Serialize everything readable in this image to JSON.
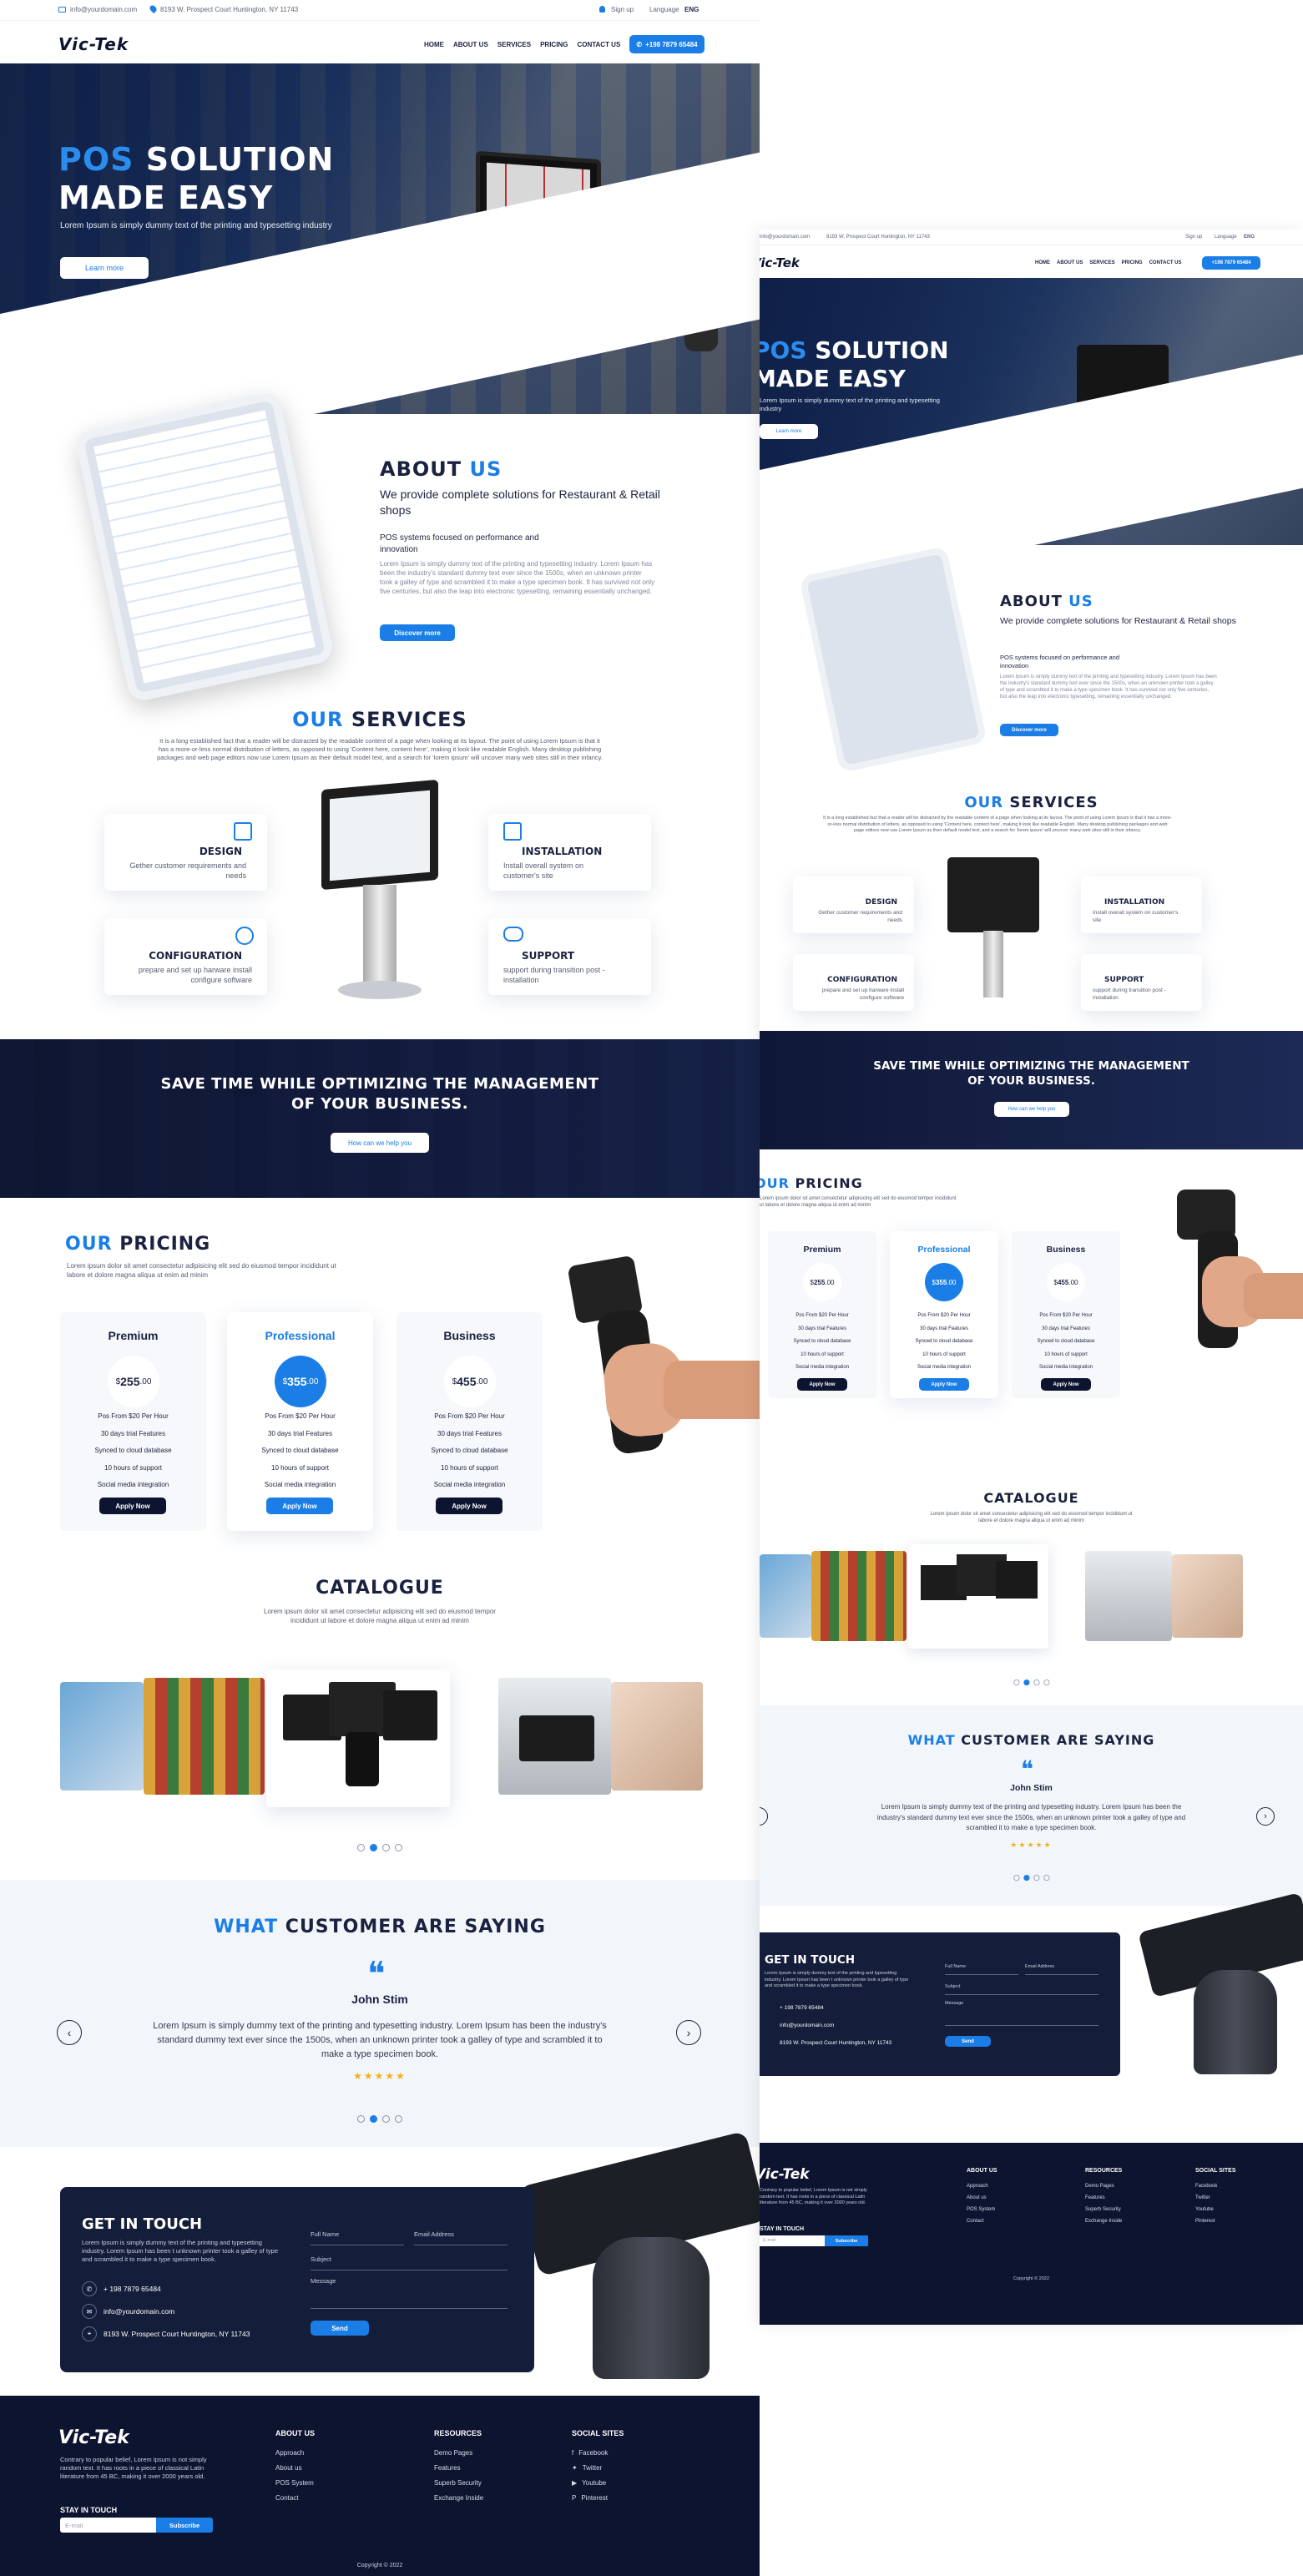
{
  "topbar": {
    "email": "info@yourdomain.com",
    "address": "8193 W. Prospect Court Huntington, NY 11743",
    "signup": "Sign up",
    "language": "Language",
    "lang_code": "ENG"
  },
  "brand": {
    "logo": "Vic-Tek",
    "accent": "#1a7ee6",
    "navy": "#0d1430"
  },
  "nav": {
    "items": [
      "HOME",
      "ABOUT US",
      "SERVICES",
      "PRICING",
      "CONTACT US"
    ],
    "phone": "+198 7879 65484"
  },
  "hero": {
    "title_accent": "POS",
    "title_rest": "SOLUTION",
    "title_line2": "MADE EASY",
    "subtitle": "Lorem Ipsum is simply dummy text of the printing and typesetting industry",
    "button": "Learn more"
  },
  "about": {
    "title_a": "ABOUT",
    "title_b": "US",
    "lead": "We provide complete solutions for  Restaurant & Retail shops",
    "sub": "POS systems focused on performance and innovation",
    "body": "Lorem Ipsum is simply dummy text of the printing and typesetting industry. Lorem Ipsum has been the industry's standard dummy text ever since the 1500s, when an unknown printer took a galley of type and scrambled it to make a type specimen book. It has survived not only five centuries, but also the leap into electronic typesetting, remaining essentially unchanged.",
    "button": "Discover more"
  },
  "services": {
    "title_a": "OUR",
    "title_b": "SERVICES",
    "intro": "It is a long established fact that a reader will be distracted by the readable content of a page when looking at its layout. The point of using Lorem Ipsum is that it has a more-or-less normal distribution of letters, as opposed to using 'Content here, content here', making it look like readable English. Many desktop publishing packages and web page editors now use Lorem Ipsum as their default model text, and a search for 'lorem ipsum' will uncover many web sites still in their infancy.",
    "items": [
      {
        "name": "DESIGN",
        "desc": "Gether customer requirements and needs",
        "icon": "design-icon"
      },
      {
        "name": "INSTALLATION",
        "desc": "Install overall system on customer's site",
        "icon": "installation-icon"
      },
      {
        "name": "CONFIGURATION",
        "desc": "prepare and set up harware install configure software",
        "icon": "configuration-icon"
      },
      {
        "name": "SUPPORT",
        "desc": "support during transition post - installation",
        "icon": "support-icon"
      }
    ]
  },
  "banner": {
    "line1": "SAVE TIME WHILE OPTIMIZING THE MANAGEMENT",
    "line2": "OF YOUR BUSINESS.",
    "button": "How can we help you"
  },
  "pricing": {
    "title_a": "OUR",
    "title_b": "PRICING",
    "intro": "Lorem ipsum dolor sit amet consectetur adipisicing elit sed do eiusmod tempor incididunt ut labore et dolore magna aliqua ut enim ad minim",
    "plans": [
      {
        "name": "Premium",
        "currency": "$",
        "price": "255",
        "cents": ".00",
        "features": [
          "Pos From $20 Per Hour",
          "30 days trial Features",
          "Synced to cloud database",
          "10 hours of support",
          "Social media integration"
        ],
        "button": "Apply Now",
        "featured": false
      },
      {
        "name": "Professional",
        "currency": "$",
        "price": "355",
        "cents": ".00",
        "features": [
          "Pos From $20 Per Hour",
          "30 days trial Features",
          "Synced to cloud database",
          "10 hours of support",
          "Social media integration"
        ],
        "button": "Apply Now",
        "featured": true
      },
      {
        "name": "Business",
        "currency": "$",
        "price": "455",
        "cents": ".00",
        "features": [
          "Pos From $20 Per Hour",
          "30 days trial Features",
          "Synced to cloud database",
          "10 hours of support",
          "Social media integration"
        ],
        "button": "Apply Now",
        "featured": false
      }
    ]
  },
  "catalogue": {
    "title": "CATALOGUE",
    "intro": "Lorem ipsum dolor sit amet consectetur adipisicing elit sed do eiusmod tempor incididunt ut labore et dolore magna aliqua ut enim ad minim"
  },
  "testimonials": {
    "title_a": "WHAT",
    "title_b": "CUSTOMER ARE SAYING",
    "name": "John Stim",
    "quote": "Lorem Ipsum is simply dummy text of the printing and typesetting industry. Lorem Ipsum has been the industry's standard dummy text ever since the 1500s, when an unknown printer took a galley of type and scrambled it to make a type specimen book.",
    "stars": "★★★★★"
  },
  "contact": {
    "title": "GET IN TOUCH",
    "body": "Lorem Ipsum is simply dummy text of the printing and typesetting industry. Lorem Ipsum has been t unknown printer took a galley of type and scrambled it to make a type specimen book.",
    "phone": "+ 198 7879 65484",
    "email": "info@yourdomain.com",
    "address": "8193 W. Prospect Court Huntington, NY 11743",
    "fields": {
      "name": "Full Name",
      "email": "Email Address",
      "subject": "Subject",
      "message": "Message"
    },
    "button": "Send"
  },
  "footer": {
    "logo": "Vic-Tek",
    "about": "Contrary to popular belief, Lorem Ipsum is not simply random text. It has roots in a piece of classical Latin literature from 45 BC, making it over 2000 years old.",
    "stay_title": "STAY IN TOUCH",
    "email_placeholder": "E-mail",
    "subscribe": "Subscribe",
    "columns": [
      {
        "title": "ABOUT US",
        "links": [
          "Approach",
          "About us",
          "POS System",
          "Contact"
        ]
      },
      {
        "title": "RESOURCES",
        "links": [
          "Demo Pages",
          "Features",
          "Superb Security",
          "Exchange Inside"
        ]
      },
      {
        "title": "SOCIAL SITES",
        "links": [
          "Facebook",
          "Twitter",
          "Youtube",
          "Pinterest"
        ]
      }
    ],
    "copyright": "Copyright © 2022"
  }
}
